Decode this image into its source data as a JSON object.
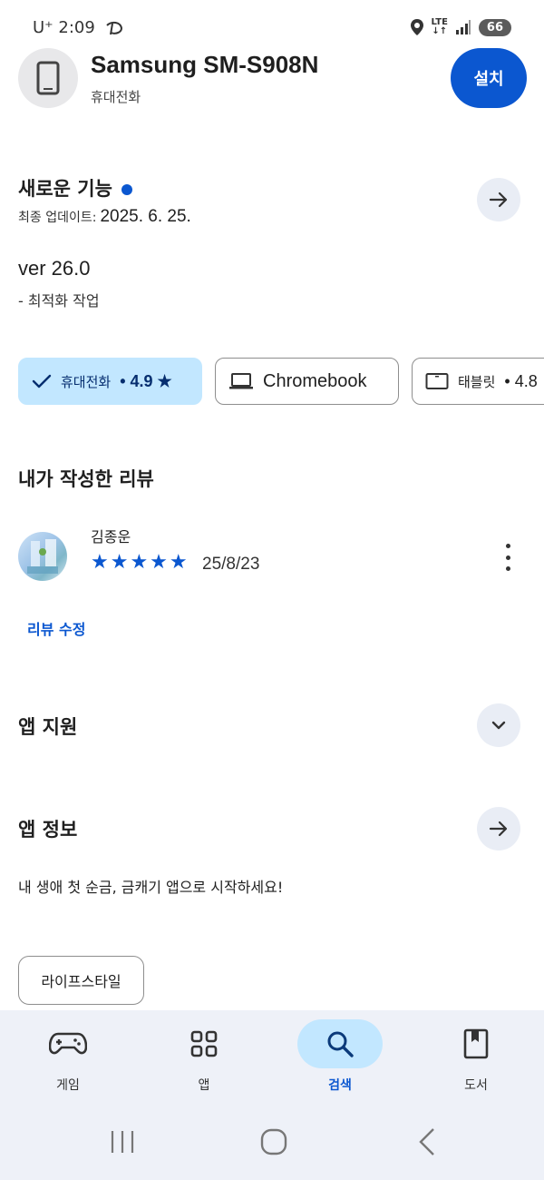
{
  "status_bar": {
    "carrier_time": "U⁺ 2:09",
    "network": "LTE",
    "battery": "66"
  },
  "header": {
    "device_name": "Samsung SM-S908N",
    "device_type": "휴대전화",
    "install_label": "설치"
  },
  "whats_new": {
    "title": "새로운 기능",
    "updated_prefix": "최종 업데이트:",
    "updated_date": "2025. 6. 25.",
    "version": "ver 26.0",
    "note": "- 최적화 작업"
  },
  "device_chips": [
    {
      "label": "휴대전화",
      "rating": "• 4.9 ★",
      "selected": true,
      "icon": "check-icon"
    },
    {
      "label": "Chromebook",
      "rating": "",
      "selected": false,
      "icon": "laptop-icon"
    },
    {
      "label": "태블릿",
      "rating": "• 4.8",
      "selected": false,
      "icon": "tablet-icon"
    }
  ],
  "my_review": {
    "title": "내가 작성한 리뷰",
    "reviewer": "김종운",
    "stars": "★★★★★",
    "rating": 5,
    "date": "25/8/23",
    "edit_label": "리뷰 수정"
  },
  "app_support": {
    "title": "앱 지원"
  },
  "app_info": {
    "title": "앱 정보",
    "description": "내 생애 첫 순금, 금캐기 앱으로 시작하세요!",
    "tag": "라이프스타일"
  },
  "bottom_nav": [
    {
      "label": "게임",
      "icon": "gamepad-icon",
      "active": false
    },
    {
      "label": "앱",
      "icon": "apps-grid-icon",
      "active": false
    },
    {
      "label": "검색",
      "icon": "search-icon",
      "active": true
    },
    {
      "label": "도서",
      "icon": "book-icon",
      "active": false
    }
  ],
  "colors": {
    "accent": "#0b57d0",
    "chip_selected_bg": "#c2e7ff",
    "nav_bg": "#eef1f8"
  }
}
